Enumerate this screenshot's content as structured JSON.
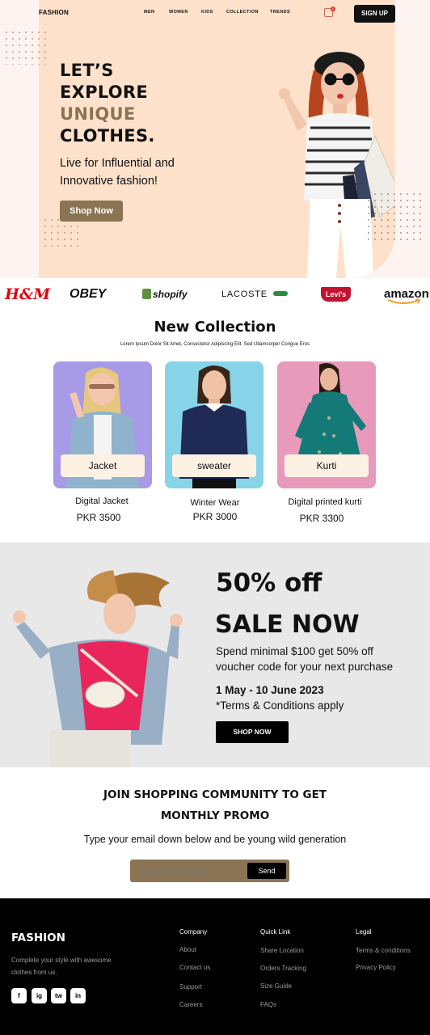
{
  "header": {
    "brand": "FASHION",
    "nav": [
      "MEN",
      "WOMEN",
      "KIDS",
      "COLLECTION",
      "TRENDS"
    ],
    "cart_count": "0",
    "signup_label": "SIGN UP"
  },
  "hero": {
    "line1": "LET’S",
    "line2": "EXPLORE",
    "line3": "UNIQUE",
    "line4": "CLOTHES.",
    "sub1": "Live for Influential and",
    "sub2": "Innovative fashion!",
    "cta": "Shop Now"
  },
  "brands": [
    "H&M",
    "OBEY",
    "shopify",
    "LACOSTE",
    "Levi's",
    "amazon"
  ],
  "collection": {
    "title": "New Collection",
    "subtitle": "Lorem Ipsum Dolor Sit Amet, Consectetur Adipiscing Elit. Sed Ullamcorper Congue Eros",
    "products": [
      {
        "label": "Jacket",
        "name": "Digital Jacket",
        "price": "PKR 3500"
      },
      {
        "label": "sweater",
        "name": "Winter Wear",
        "price": "PKR 3000"
      },
      {
        "label": "Kurti",
        "name": "Digital printed kurti",
        "price": "PKR 3300"
      }
    ]
  },
  "sale": {
    "off": "50% off",
    "headline": "SALE NOW",
    "line1": "Spend minimal $100 get 50% off",
    "line2": "voucher code for your next purchase",
    "dates": "1 May - 10 June 2023",
    "terms": "*Terms & Conditions apply",
    "cta": "SHOP NOW"
  },
  "newsletter": {
    "title1": "JOIN SHOPPING COMMUNITY TO GET",
    "title2": "MONTHLY PROMO",
    "subtitle": "Type your email down below and be young wild generation",
    "placeholder": "Add your email here",
    "send": "Send"
  },
  "footer": {
    "brand": "FASHION",
    "desc1": "Complete your style with awesome",
    "desc2": "clothes from us.",
    "company": {
      "heading": "Company",
      "links": [
        "About",
        "Contact us",
        "Support",
        "Careers"
      ]
    },
    "quick": {
      "heading": "Quick Link",
      "links": [
        "Share Location",
        "Orders Tracking",
        "Size Guide",
        "FAQs"
      ]
    },
    "legal": {
      "heading": "Legal",
      "links": [
        "Terms & conditions",
        "Privacy Policy"
      ]
    },
    "social": [
      "f",
      "ig",
      "tw",
      "in"
    ]
  },
  "colors": {
    "accent": "#8a7453",
    "hero_bg": "#fde1cb",
    "dark": "#111111"
  }
}
